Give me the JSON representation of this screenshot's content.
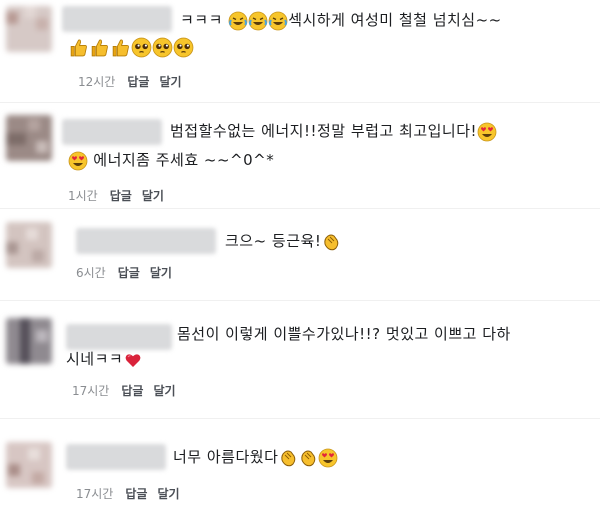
{
  "comments": [
    {
      "text_suffix": "ㅋㅋㅋ",
      "text_main": "섹시하게 여성미 철철 넘치심~~",
      "time": "12시간",
      "reply": "답글",
      "like": "달기"
    },
    {
      "text_main": "범접할수없는 에너지!!정말 부럽고 최고입니다!",
      "text_line2": "에너지좀 주세효 ~~^0^*",
      "time": "1시간",
      "reply": "답글",
      "like": "달기"
    },
    {
      "text_main": "크으~ 등근육!",
      "time": "6시간",
      "reply": "답글",
      "like": "달기"
    },
    {
      "text_main": "몸선이 이렇게 이쁠수가있나!!? 멋있고 이쁘고 다하",
      "text_line2": "시네ㅋㅋ",
      "time": "17시간",
      "reply": "답글",
      "like": "달기"
    },
    {
      "text_main": "너무 아름다웠다",
      "time": "17시간",
      "reply": "답글",
      "like": "달기"
    }
  ],
  "icons": {
    "laugh": "tears-of-joy-emoji",
    "thumb": "thumbs-up-emoji",
    "pleading": "pleading-face-emoji",
    "heart_eyes": "heart-eyes-emoji",
    "clap": "clapping-hands-emoji",
    "heart": "red-heart-emoji"
  }
}
